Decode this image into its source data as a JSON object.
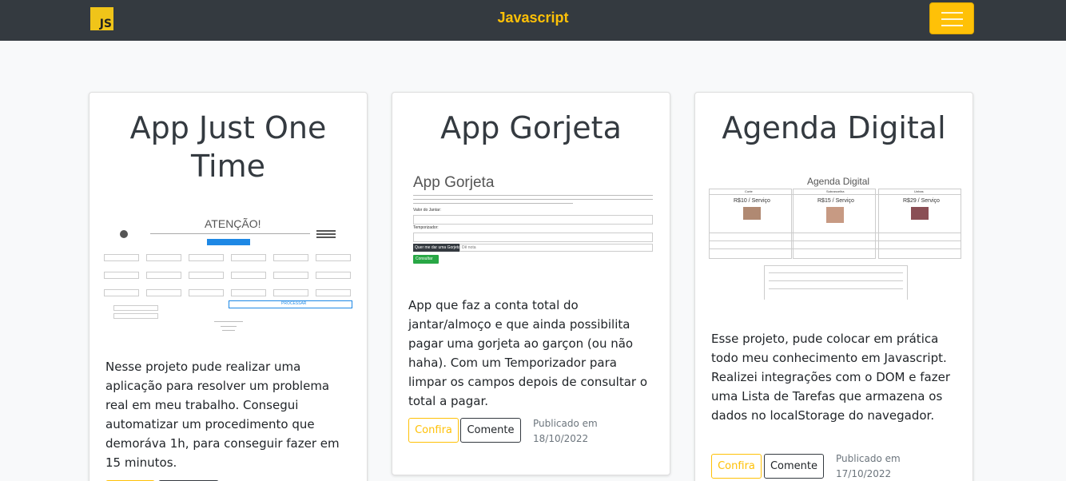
{
  "navbar": {
    "logo_text": "JS",
    "brand": "Javascript",
    "toggler_icon": "hamburger-icon"
  },
  "colors": {
    "navbar_bg": "#343a40",
    "accent": "#ffc107",
    "page_bg": "#f8f9fa"
  },
  "cards": [
    {
      "title": "App Just One Time",
      "text": "Nesse projeto pude realizar uma aplicação para resolver um problema real em meu trabalho. Consegui automatizar um procedimento que demoráva 1h, para conseguir fazer em 15 minutos.",
      "shot": {
        "heading": "ATENÇÃO!",
        "button": "PROCESSAR",
        "fields": [
          "Nome",
          "Data",
          "Valor",
          "Tipo",
          "Quantidade"
        ]
      }
    },
    {
      "title": "App Gorjeta",
      "text": "App que faz a conta total do jantar/almoço e que ainda possibilita pagar uma gorjeta ao garçon (ou não haha). Com um Temporizador para limpar os campos depois de consultar o total a pagar.",
      "confirm": "Confira",
      "comment": "Comente",
      "published_label": "Publicado em",
      "published_date": "18/10/2022",
      "shot": {
        "heading": "App Gorjeta",
        "label1": "Valor do Jantar:",
        "label2": "Temporizador:",
        "select_btn": "Quer me dar uma Gorjeta?",
        "select_value": "Dê nota",
        "submit": "Consultar"
      }
    },
    {
      "title": "Agenda Digital",
      "text": "Esse projeto, pude colocar em prática todo meu conhecimento em Javascript. Realizei integrações com o DOM e fazer uma Lista de Tarefas que armazena os dados no localStorage do navegador.",
      "confirm": "Confira",
      "comment": "Comente",
      "published_label": "Publicado em",
      "published_date": "17/10/2022",
      "shot": {
        "heading": "Agenda Digital",
        "prices": [
          "R$10 / Serviço",
          "R$15 / Serviço",
          "R$29 / Serviço"
        ],
        "columns": [
          "Corte",
          "Sobrancelha",
          "Unhas"
        ]
      }
    }
  ]
}
